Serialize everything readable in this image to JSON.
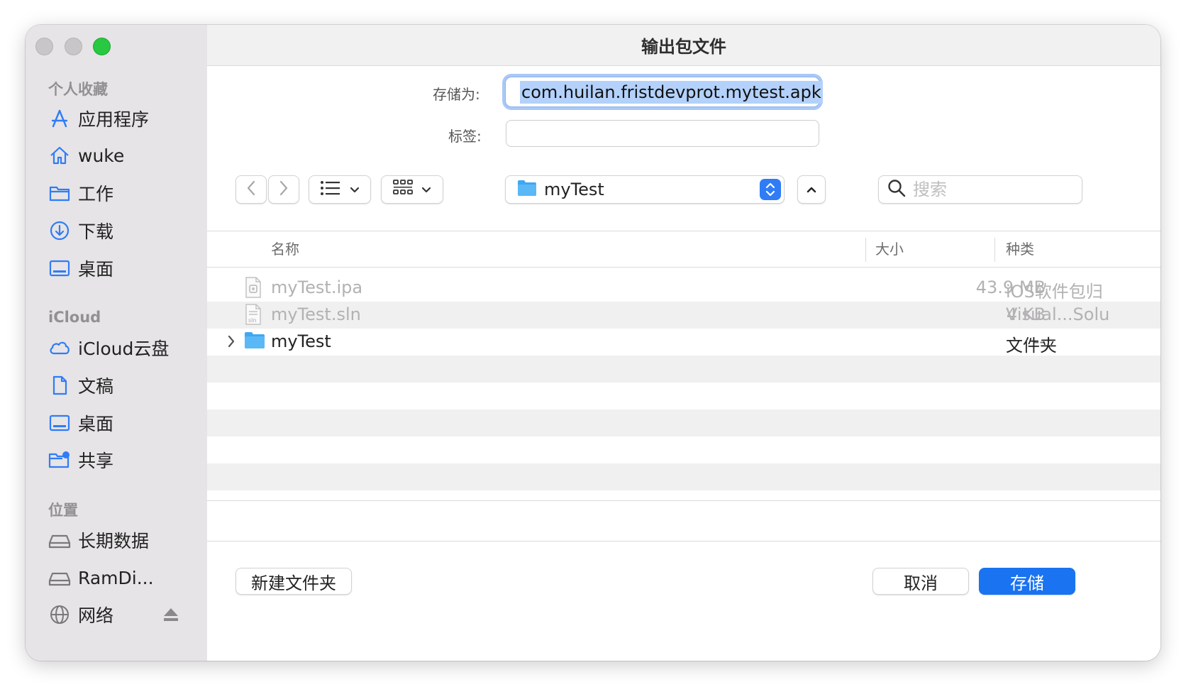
{
  "window": {
    "title": "输出包文件"
  },
  "colors": {
    "accent": "#1a73f0",
    "sidebar_icon": "#2f7cf6",
    "zoom_button": "#28c840",
    "folder": "#3fa7f2"
  },
  "sidebar": {
    "favorites_header": "个人收藏",
    "favorites": [
      {
        "label": "应用程序",
        "icon": "applications-icon"
      },
      {
        "label": "wuke",
        "icon": "home-icon"
      },
      {
        "label": "工作",
        "icon": "folder-icon"
      },
      {
        "label": "下载",
        "icon": "download-icon"
      },
      {
        "label": "桌面",
        "icon": "desktop-icon"
      }
    ],
    "icloud_header": "iCloud",
    "icloud": [
      {
        "label": "iCloud云盘",
        "icon": "cloud-icon"
      },
      {
        "label": "文稿",
        "icon": "document-icon"
      },
      {
        "label": "桌面",
        "icon": "desktop-icon"
      },
      {
        "label": "共享",
        "icon": "shared-folder-icon"
      }
    ],
    "locations_header": "位置",
    "locations": [
      {
        "label": "长期数据",
        "icon": "drive-icon"
      },
      {
        "label": "RamDi...",
        "icon": "drive-icon"
      },
      {
        "label": "网络",
        "icon": "network-icon"
      }
    ]
  },
  "form": {
    "save_as_label": "存储为:",
    "save_as_value": "com.huilan.fristdevprot.mytest.apk",
    "tags_label": "标签:",
    "tags_value": ""
  },
  "toolbar": {
    "location": "myTest",
    "search_placeholder": "搜索"
  },
  "file_list": {
    "columns": {
      "name": "名称",
      "size": "大小",
      "kind": "种类"
    },
    "rows": [
      {
        "name": "myTest.ipa",
        "size": "43.9 MB",
        "kind": "iOS软件包归",
        "icon": "ipa-file-icon",
        "enabled": false
      },
      {
        "name": "myTest.sln",
        "size": "4 KB",
        "kind": "Visual...Solu",
        "icon": "sln-file-icon",
        "enabled": false
      },
      {
        "name": "myTest",
        "size": "--",
        "kind": "文件夹",
        "icon": "folder-icon",
        "enabled": true
      }
    ]
  },
  "footer": {
    "new_folder": "新建文件夹",
    "cancel": "取消",
    "save": "存储"
  }
}
